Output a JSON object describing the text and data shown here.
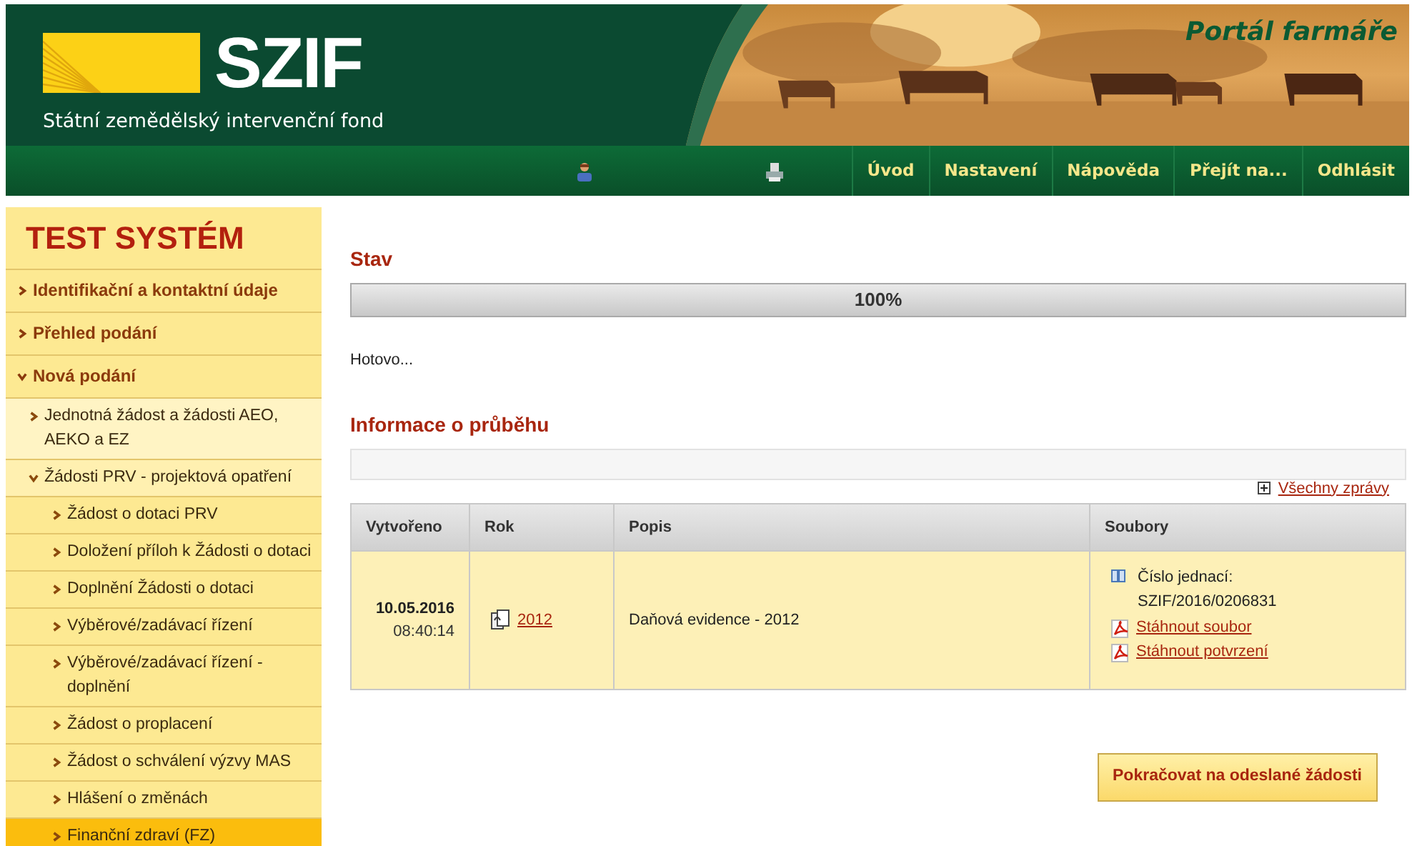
{
  "header": {
    "logo_text": "SZIF",
    "subtitle": "Státní zemědělský intervenční fond",
    "portal_title": "Portál farmáře"
  },
  "nav": {
    "items": [
      "Úvod",
      "Nastavení",
      "Nápověda",
      "Přejít na...",
      "Odhlásit"
    ]
  },
  "sidebar": {
    "title": "TEST SYSTÉM",
    "items": [
      {
        "label": "Identifikační a kontaktní údaje",
        "expanded": false,
        "selected": false
      },
      {
        "label": "Přehled podání",
        "expanded": false,
        "selected": false
      },
      {
        "label": "Nová podání",
        "expanded": true,
        "selected": false,
        "children": [
          {
            "label": "Jednotná žádost a žádosti AEO, AEKO a EZ",
            "expanded": false,
            "selected": false
          },
          {
            "label": "Žádosti PRV - projektová opatření",
            "expanded": true,
            "selected": false,
            "children": [
              {
                "label": "Žádost o dotaci PRV",
                "expanded": false,
                "selected": false
              },
              {
                "label": "Doložení příloh k Žádosti o dotaci",
                "expanded": false,
                "selected": false
              },
              {
                "label": "Doplnění Žádosti o dotaci",
                "expanded": false,
                "selected": false
              },
              {
                "label": "Výběrové/zadávací řízení",
                "expanded": false,
                "selected": false
              },
              {
                "label": "Výběrové/zadávací řízení - doplnění",
                "expanded": false,
                "selected": false
              },
              {
                "label": "Žádost o proplacení",
                "expanded": false,
                "selected": false
              },
              {
                "label": "Žádost o schválení výzvy MAS",
                "expanded": false,
                "selected": false
              },
              {
                "label": "Hlášení o změnách",
                "expanded": false,
                "selected": false
              },
              {
                "label": "Finanční zdraví (FZ)",
                "expanded": false,
                "selected": true
              }
            ]
          }
        ]
      }
    ]
  },
  "status": {
    "heading": "Stav",
    "progress": {
      "level": 1,
      "reading": "100%"
    },
    "message": "Hotovo..."
  },
  "progress_info": {
    "heading": "Informace o průběhu",
    "all_messages_link": "Všechny zprávy"
  },
  "table": {
    "columns": [
      "Vytvořeno",
      "Rok",
      "Popis",
      "Soubory"
    ],
    "rows": [
      {
        "date": "10.05.2016",
        "time": "08:40:14",
        "year": "2012",
        "description": "Daňová evidence - 2012",
        "reference_label": "Číslo jednací:",
        "reference_value": "SZIF/2016/0206831",
        "files": [
          "Stáhnout soubor",
          "Stáhnout potvrzení"
        ]
      }
    ]
  },
  "continue_button": "Pokračovat na odeslané žádosti"
}
